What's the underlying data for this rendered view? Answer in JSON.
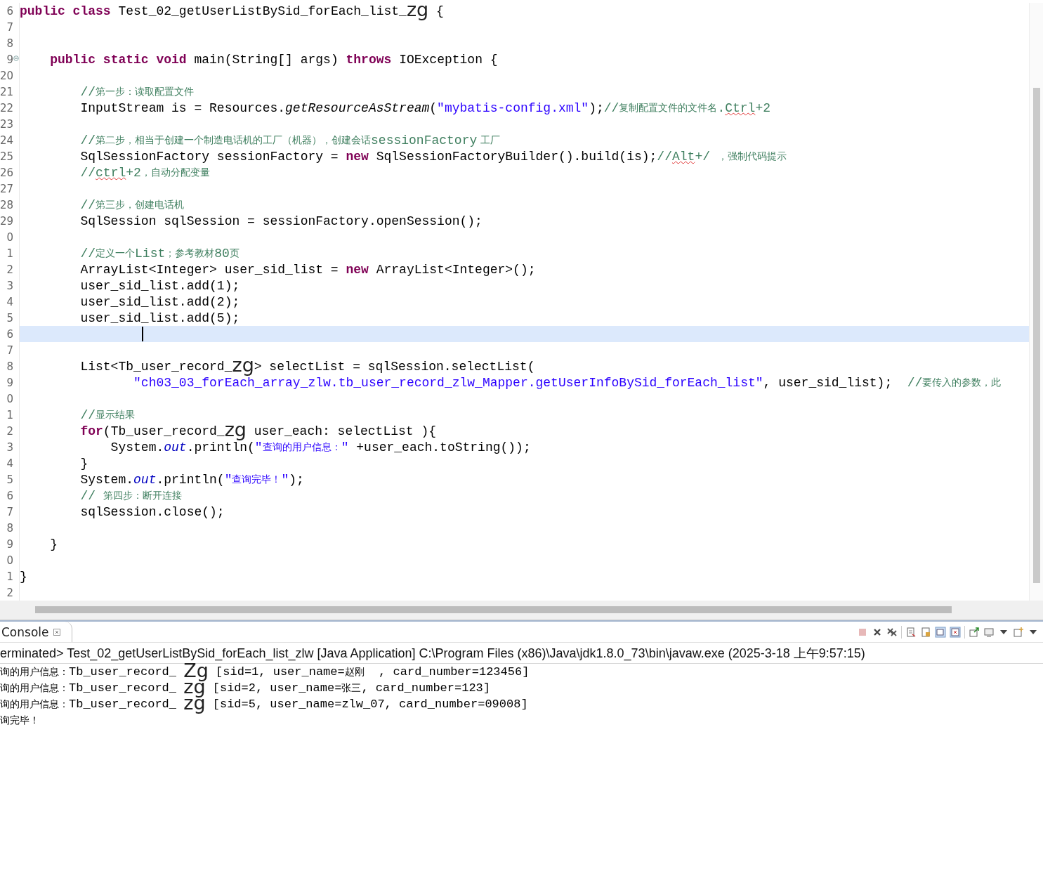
{
  "editor": {
    "lines": [
      {
        "number": "6",
        "current": false,
        "fold": false,
        "tokens": [
          {
            "kind": "keyword",
            "text": "public"
          },
          {
            "kind": "keyword",
            "text": " class"
          },
          {
            "kind": "plain",
            "text": " Test_02_getUserListBySid_forEach_list_"
          },
          {
            "kind": "big",
            "text": "zg"
          },
          {
            "kind": "plain",
            "text": " {"
          }
        ]
      },
      {
        "number": "7",
        "current": false,
        "fold": false
      },
      {
        "number": "8",
        "current": false,
        "fold": false
      },
      {
        "number": "9",
        "current": false,
        "fold": true,
        "tokens": [
          {
            "kind": "keyword",
            "text": "    public"
          },
          {
            "kind": "keyword",
            "text": " static"
          },
          {
            "kind": "keyword",
            "text": " void"
          },
          {
            "kind": "plain",
            "text": " main(String[] args) "
          },
          {
            "kind": "keyword",
            "text": "throws"
          },
          {
            "kind": "plain",
            "text": " IOException {"
          }
        ]
      },
      {
        "number": "20",
        "current": false,
        "fold": false
      },
      {
        "number": "21",
        "current": false,
        "fold": false,
        "tokens": [
          {
            "kind": "comment",
            "text": "        //"
          },
          {
            "kind": "comment_cjk",
            "text": "第一步：读取配置文件"
          }
        ]
      },
      {
        "number": "22",
        "current": false,
        "fold": false,
        "tokens": [
          {
            "kind": "plain",
            "text": "        InputStream is = Resources."
          },
          {
            "kind": "static_method",
            "text": "getResourceAsStream"
          },
          {
            "kind": "plain",
            "text": "("
          },
          {
            "kind": "string",
            "text": "\"mybatis-config.xml\""
          },
          {
            "kind": "plain",
            "text": ");"
          },
          {
            "kind": "comment",
            "text": "//"
          },
          {
            "kind": "comment_cjk",
            "text": "复制配置文件的文件名"
          },
          {
            "kind": "comment",
            "text": "."
          },
          {
            "kind": "misspelled",
            "text": "Ctrl"
          },
          {
            "kind": "comment",
            "text": "+2"
          }
        ]
      },
      {
        "number": "23",
        "current": false,
        "fold": false
      },
      {
        "number": "24",
        "current": false,
        "fold": false,
        "tokens": [
          {
            "kind": "comment",
            "text": "        //"
          },
          {
            "kind": "comment_cjk",
            "text": "第二步，相当于创建一个制造电话机的工厂（机器），创建会话"
          },
          {
            "kind": "comment",
            "text": "sessionFactory"
          },
          {
            "kind": "comment_cjk",
            "text": " 工厂"
          }
        ]
      },
      {
        "number": "25",
        "current": false,
        "fold": false,
        "tokens": [
          {
            "kind": "plain",
            "text": "        SqlSessionFactory sessionFactory = "
          },
          {
            "kind": "keyword",
            "text": "new"
          },
          {
            "kind": "plain",
            "text": " SqlSessionFactoryBuilder().build(is);"
          },
          {
            "kind": "comment",
            "text": "//"
          },
          {
            "kind": "misspelled",
            "text": "Alt"
          },
          {
            "kind": "comment",
            "text": "+/ "
          },
          {
            "kind": "comment_cjk",
            "text": "，强制代码提示"
          }
        ]
      },
      {
        "number": "26",
        "current": false,
        "fold": false,
        "tokens": [
          {
            "kind": "comment",
            "text": "        //"
          },
          {
            "kind": "misspelled",
            "text": "ctrl"
          },
          {
            "kind": "comment",
            "text": "+2"
          },
          {
            "kind": "comment_cjk",
            "text": "，自动分配变量"
          }
        ]
      },
      {
        "number": "27",
        "current": false,
        "fold": false
      },
      {
        "number": "28",
        "current": false,
        "fold": false,
        "tokens": [
          {
            "kind": "comment",
            "text": "        //"
          },
          {
            "kind": "comment_cjk",
            "text": "第三步，创建电话机"
          }
        ]
      },
      {
        "number": "29",
        "current": false,
        "fold": false,
        "tokens": [
          {
            "kind": "plain",
            "text": "        SqlSession sqlSession = sessionFactory.openSession();"
          }
        ]
      },
      {
        "number": "0",
        "current": false,
        "fold": false
      },
      {
        "number": "1",
        "current": false,
        "fold": false,
        "tokens": [
          {
            "kind": "comment",
            "text": "        //"
          },
          {
            "kind": "comment_cjk",
            "text": "定义一个"
          },
          {
            "kind": "comment",
            "text": "List"
          },
          {
            "kind": "comment_cjk",
            "text": "；参考教材"
          },
          {
            "kind": "comment",
            "text": "80"
          },
          {
            "kind": "comment_cjk",
            "text": "页"
          }
        ]
      },
      {
        "number": "2",
        "current": false,
        "fold": false,
        "tokens": [
          {
            "kind": "plain",
            "text": "        ArrayList<Integer> user_sid_list = "
          },
          {
            "kind": "keyword",
            "text": "new"
          },
          {
            "kind": "plain",
            "text": " ArrayList<Integer>();"
          }
        ]
      },
      {
        "number": "3",
        "current": false,
        "fold": false,
        "tokens": [
          {
            "kind": "plain",
            "text": "        user_sid_list.add(1);"
          }
        ]
      },
      {
        "number": "4",
        "current": false,
        "fold": false,
        "tokens": [
          {
            "kind": "plain",
            "text": "        user_sid_list.add(2);"
          }
        ]
      },
      {
        "number": "5",
        "current": false,
        "fold": false,
        "tokens": [
          {
            "kind": "plain",
            "text": "        user_sid_list.add(5);"
          }
        ]
      },
      {
        "number": "6",
        "current": true,
        "fold": false
      },
      {
        "number": "7",
        "current": false,
        "fold": false
      },
      {
        "number": "8",
        "current": false,
        "fold": false,
        "tokens": [
          {
            "kind": "plain",
            "text": "        List<Tb_user_record_"
          },
          {
            "kind": "big",
            "text": "zg"
          },
          {
            "kind": "plain",
            "text": "> selectList = sqlSession.selectList("
          }
        ]
      },
      {
        "number": "9",
        "current": false,
        "fold": false,
        "tokens": [
          {
            "kind": "string",
            "text": "               \"ch03_03_forEach_array_zlw.tb_user_record_zlw_Mapper.getUserInfoBySid_forEach_list\""
          },
          {
            "kind": "plain",
            "text": ", user_sid_list);  "
          },
          {
            "kind": "comment",
            "text": "//"
          },
          {
            "kind": "comment_cjk",
            "text": "要传入的参数，此"
          }
        ]
      },
      {
        "number": "0",
        "current": false,
        "fold": false
      },
      {
        "number": "1",
        "current": false,
        "fold": false,
        "tokens": [
          {
            "kind": "comment",
            "text": "        //"
          },
          {
            "kind": "comment_cjk",
            "text": "显示结果"
          }
        ]
      },
      {
        "number": "2",
        "current": false,
        "fold": false,
        "tokens": [
          {
            "kind": "keyword",
            "text": "        for"
          },
          {
            "kind": "plain",
            "text": "(Tb_user_record_"
          },
          {
            "kind": "big",
            "text": "zg"
          },
          {
            "kind": "plain",
            "text": " user_each: selectList ){"
          }
        ]
      },
      {
        "number": "3",
        "current": false,
        "fold": false,
        "tokens": [
          {
            "kind": "plain",
            "text": "            System."
          },
          {
            "kind": "static_field",
            "text": "out"
          },
          {
            "kind": "plain",
            "text": ".println("
          },
          {
            "kind": "string",
            "text": "\""
          },
          {
            "kind": "string_cjk",
            "text": "查询的用户信息："
          },
          {
            "kind": "string",
            "text": "\""
          },
          {
            "kind": "plain",
            "text": " +user_each.toString());"
          }
        ]
      },
      {
        "number": "4",
        "current": false,
        "fold": false,
        "tokens": [
          {
            "kind": "plain",
            "text": "        }"
          }
        ]
      },
      {
        "number": "5",
        "current": false,
        "fold": false,
        "tokens": [
          {
            "kind": "plain",
            "text": "        System."
          },
          {
            "kind": "static_field",
            "text": "out"
          },
          {
            "kind": "plain",
            "text": ".println("
          },
          {
            "kind": "string",
            "text": "\""
          },
          {
            "kind": "string_cjk",
            "text": "查询完毕！"
          },
          {
            "kind": "string",
            "text": "\""
          },
          {
            "kind": "plain",
            "text": ");"
          }
        ]
      },
      {
        "number": "6",
        "current": false,
        "fold": false,
        "tokens": [
          {
            "kind": "comment",
            "text": "        // "
          },
          {
            "kind": "comment_cjk",
            "text": "第四步：断开连接"
          }
        ]
      },
      {
        "number": "7",
        "current": false,
        "fold": false,
        "tokens": [
          {
            "kind": "plain",
            "text": "        sqlSession.close();"
          }
        ]
      },
      {
        "number": "8",
        "current": false,
        "fold": false
      },
      {
        "number": "9",
        "current": false,
        "fold": false,
        "tokens": [
          {
            "kind": "plain",
            "text": "    }"
          }
        ]
      },
      {
        "number": "0",
        "current": false,
        "fold": false
      },
      {
        "number": "1",
        "current": false,
        "fold": false,
        "tokens": [
          {
            "kind": "plain",
            "text": "}"
          }
        ]
      },
      {
        "number": "2",
        "current": false,
        "fold": false
      }
    ]
  },
  "console": {
    "tab": "Console",
    "header": "erminated> Test_02_getUserListBySid_forEach_list_zlw [Java Application] C:\\Program Files (x86)\\Java\\jdk1.8.0_73\\bin\\javaw.exe (2025-3-18 上午9:57:15)",
    "output": [
      {
        "tokens": [
          {
            "kind": "cjk",
            "text": "询的用户信息："
          },
          {
            "kind": "plain",
            "text": "Tb_user_record_ "
          },
          {
            "kind": "big",
            "text": "Zg"
          },
          {
            "kind": "plain",
            "text": " [sid=1, user_name="
          },
          {
            "kind": "cjk",
            "text": "赵刚"
          },
          {
            "kind": "plain",
            "text": "  , card_number=123456]"
          }
        ]
      },
      {
        "tokens": [
          {
            "kind": "cjk",
            "text": "询的用户信息："
          },
          {
            "kind": "plain",
            "text": "Tb_user_record_ "
          },
          {
            "kind": "big",
            "text": "zg"
          },
          {
            "kind": "plain",
            "text": " [sid=2, user_name="
          },
          {
            "kind": "cjk",
            "text": "张三"
          },
          {
            "kind": "plain",
            "text": ", card_number=123]"
          }
        ]
      },
      {
        "tokens": [
          {
            "kind": "cjk",
            "text": "询的用户信息："
          },
          {
            "kind": "plain",
            "text": "Tb_user_record_ "
          },
          {
            "kind": "big",
            "text": "zg"
          },
          {
            "kind": "plain",
            "text": " [sid=5, user_name=zlw_07, card_number=09008]"
          }
        ]
      },
      {
        "tokens": [
          {
            "kind": "cjk",
            "text": "询完毕！"
          }
        ]
      }
    ]
  }
}
